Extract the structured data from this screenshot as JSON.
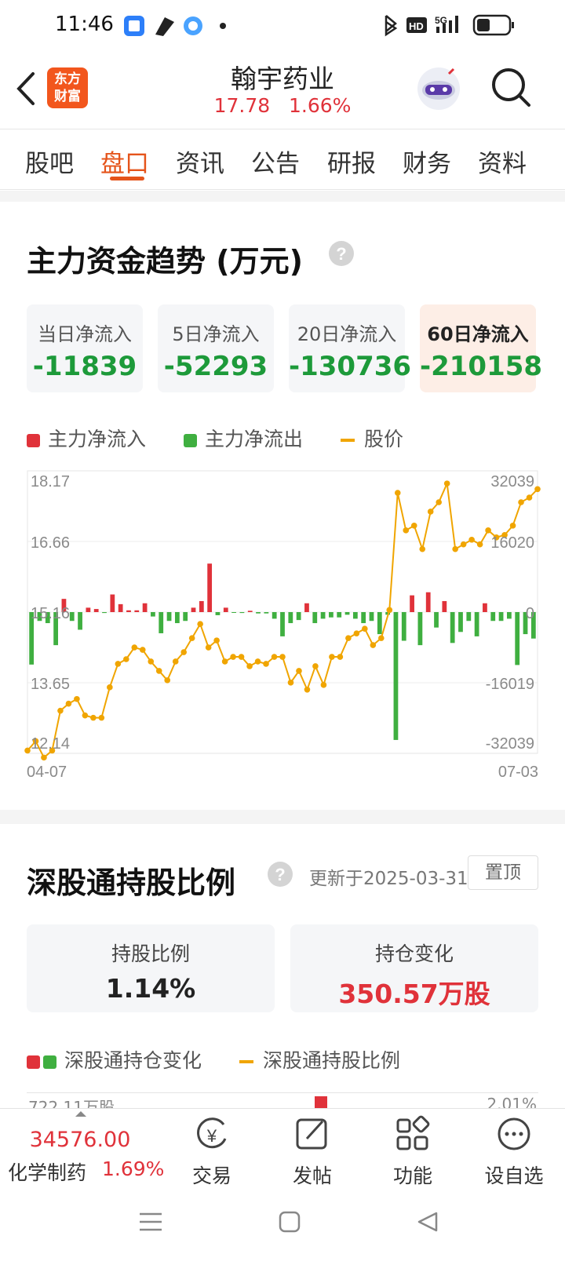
{
  "status": {
    "time": "11:46",
    "network": "5G"
  },
  "header": {
    "logo_line1": "东方",
    "logo_line2": "财富",
    "title": "翰宇药业",
    "price": "17.78",
    "change": "1.66%"
  },
  "tabs": [
    "股吧",
    "盘口",
    "资讯",
    "公告",
    "研报",
    "财务",
    "资料"
  ],
  "active_tab": "盘口",
  "flow_section": {
    "title": "主力资金趋势 (万元)",
    "cards": [
      {
        "label": "当日净流入",
        "value": "-11839"
      },
      {
        "label": "5日净流入",
        "value": "-52293"
      },
      {
        "label": "20日净流入",
        "value": "-130736"
      },
      {
        "label": "60日净流入",
        "value": "-210158"
      }
    ],
    "legend": [
      "主力净流入",
      "主力净流出",
      "股价"
    ]
  },
  "chart_data": {
    "type": "bar",
    "left_ticks": [
      "18.17",
      "16.66",
      "15.16",
      "13.65",
      "12.14"
    ],
    "right_ticks": [
      "32039",
      "16020",
      "0",
      "-16019",
      "-32039"
    ],
    "x_start": "04-07",
    "x_end": "07-03",
    "price_range": [
      12.14,
      18.17
    ],
    "flow_range": [
      -32039,
      32039
    ],
    "series": [
      {
        "name": "主力净流入/主力净流出",
        "values": [
          -11900,
          -2000,
          -2500,
          -7500,
          3000,
          -2000,
          -4000,
          1000,
          700,
          -200,
          4000,
          1800,
          400,
          400,
          2000,
          -1000,
          -4800,
          -2000,
          -2500,
          -2000,
          1000,
          2500,
          11000,
          -700,
          1000,
          -100,
          -200,
          300,
          -300,
          -300,
          -1500,
          -5500,
          -2500,
          -1800,
          2000,
          -2500,
          -1500,
          -1200,
          -1200,
          -600,
          -1500,
          -2500,
          -2000,
          -5000,
          -600,
          -29000,
          -6500,
          3800,
          -7500,
          4500,
          -3500,
          2500,
          -7000,
          -4500,
          -2000,
          -5500,
          2000,
          -2000,
          -2000,
          -1500,
          -12000,
          -5000,
          -6000
        ]
      },
      {
        "name": "股价",
        "values": [
          12.2,
          12.4,
          12.05,
          12.2,
          13.05,
          13.2,
          13.3,
          12.95,
          12.9,
          12.9,
          13.55,
          14.05,
          14.15,
          14.4,
          14.35,
          14.1,
          13.9,
          13.7,
          14.1,
          14.3,
          14.6,
          14.9,
          14.4,
          14.55,
          14.1,
          14.2,
          14.2,
          14.0,
          14.1,
          14.05,
          14.2,
          14.2,
          13.65,
          13.9,
          13.5,
          14.0,
          13.6,
          14.2,
          14.2,
          14.6,
          14.7,
          14.8,
          14.45,
          14.6,
          15.2,
          17.7,
          16.9,
          17.0,
          16.5,
          17.3,
          17.5,
          17.9,
          16.5,
          16.6,
          16.7,
          16.6,
          16.9,
          16.75,
          16.8,
          17.0,
          17.5,
          17.6,
          17.78
        ]
      }
    ]
  },
  "hk_section": {
    "title": "深股通持股比例",
    "updated": "更新于2025-03-31",
    "pin_label": "置顶",
    "cards": [
      {
        "label": "持股比例",
        "value": "1.14%"
      },
      {
        "label": "持仓变化",
        "value": "350.57万股"
      }
    ],
    "legend": [
      "深股通持仓变化",
      "深股通持股比例"
    ],
    "left_tick": "722.11万股",
    "right_tick": "2.01%"
  },
  "bottom_bar": {
    "index_value": "34576.00",
    "index_name": "化学制药",
    "index_change": "1.69%",
    "items": [
      "交易",
      "发帖",
      "功能",
      "设自选"
    ]
  },
  "colors": {
    "red": "#e0323a",
    "green": "#3faf40",
    "price_line": "#f0a500",
    "accent": "#e5541b"
  }
}
